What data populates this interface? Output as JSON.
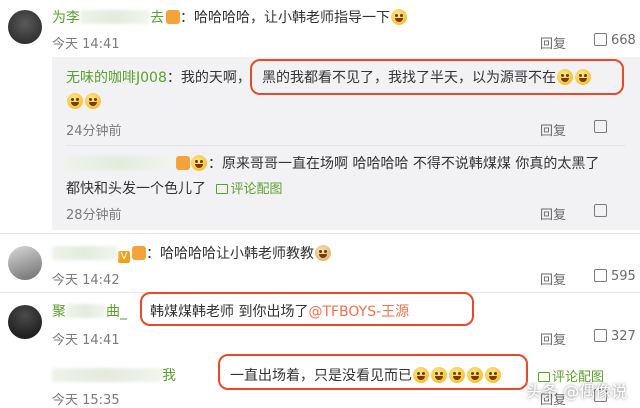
{
  "comments": [
    {
      "username_prefix": "为李",
      "username_suffix": "去",
      "text": "：哈哈哈哈，让小韩老师指导一下",
      "time": "今天 14:41",
      "reply_label": "回复",
      "likes": "668",
      "replies": [
        {
          "username": "无味的咖啡J008",
          "text_before": "：我的天啊，",
          "text_highlight": "黑的我都看不见了，我找了半天，以为源哥不在",
          "time": "24分钟前",
          "reply_label": "回复"
        },
        {
          "text": "：原来哥哥一直在场啊 哈哈哈哈 不得不说韩煤煤 你真的太黑了",
          "text_line2": "都快和头发一个色儿了",
          "pic_link": "评论配图",
          "time": "28分钟前",
          "reply_label": "回复"
        }
      ]
    },
    {
      "text": "：哈哈哈哈让小韩老师教教",
      "time": "今天 14:42",
      "reply_label": "回复",
      "likes": "595"
    },
    {
      "username_prefix": "聚",
      "username_suffix": "曲_",
      "text_highlight": "韩煤煤韩老师 到你出场了",
      "mention": "@TFBOYS-王源",
      "time": "今天 14:41",
      "reply_label": "回复",
      "likes": "327"
    },
    {
      "username_suffix": "我",
      "text_highlight": "一直出场着，只是没看见而已",
      "pic_link": "评论配图",
      "time": "今天 15:35",
      "reply_label": "回复"
    }
  ],
  "watermark": "头条 @偶像说",
  "colors": {
    "username": "#5b9f2f",
    "highlight_box": "#e44b2a",
    "mention": "#eb7350"
  }
}
